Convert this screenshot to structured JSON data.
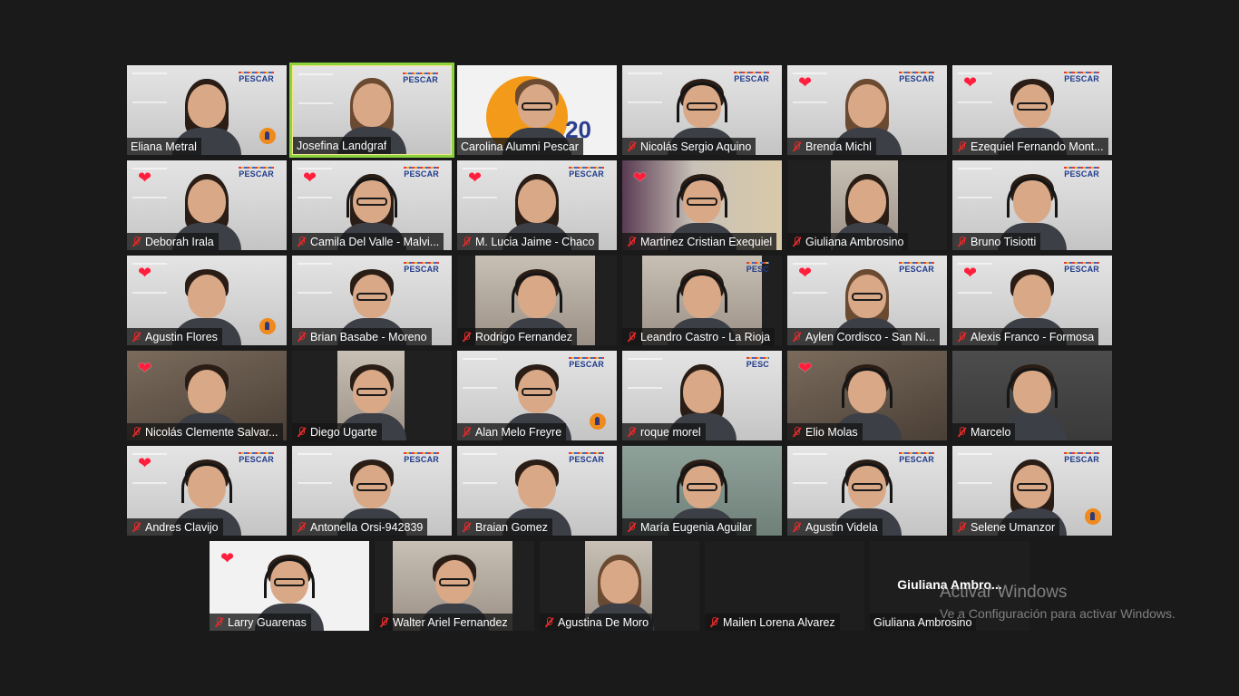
{
  "app": "Zoom gallery view",
  "participants": [
    {
      "name": "Eliana Metral",
      "muted": false,
      "heart": false,
      "brand": "PESCAR"
    },
    {
      "name": "Josefina Landgraf",
      "muted": false,
      "heart": false,
      "brand": "PESCAR",
      "speaking": true
    },
    {
      "name": "Carolina Alumni Pescar",
      "muted": false,
      "heart": false,
      "brand_text": "20"
    },
    {
      "name": "Nicolás Sergio Aquino",
      "muted": true,
      "heart": false,
      "brand": "PESCAR"
    },
    {
      "name": "Brenda Michl",
      "muted": true,
      "heart": true,
      "brand": "PESCAR"
    },
    {
      "name": "Ezequiel Fernando Mont...",
      "muted": true,
      "heart": true,
      "brand": "PESCAR"
    },
    {
      "name": "Deborah Irala",
      "muted": true,
      "heart": true,
      "brand": "PESCAR"
    },
    {
      "name": "Camila Del Valle - Malvi...",
      "muted": true,
      "heart": true,
      "brand": "PESCAR"
    },
    {
      "name": "M. Lucia Jaime - Chaco",
      "muted": true,
      "heart": true,
      "brand": "PESCAR"
    },
    {
      "name": "Martinez Cristian Exequiel",
      "muted": true,
      "heart": true
    },
    {
      "name": "Giuliana Ambrosino",
      "muted": true,
      "heart": false
    },
    {
      "name": "Bruno Tisiotti",
      "muted": true,
      "heart": false,
      "brand": "PESCAR"
    },
    {
      "name": "Agustin Flores",
      "muted": true,
      "heart": true
    },
    {
      "name": "Brian Basabe - Moreno",
      "muted": true,
      "heart": false,
      "brand": "PESCAR"
    },
    {
      "name": "Rodrigo Fernandez",
      "muted": true,
      "heart": false
    },
    {
      "name": "Leandro Castro - La Rioja",
      "muted": true,
      "heart": false,
      "brand": "PESC"
    },
    {
      "name": "Aylen Cordisco -  San Ni...",
      "muted": true,
      "heart": true,
      "brand": "PESCAR"
    },
    {
      "name": "Alexis Franco - Formosa",
      "muted": true,
      "heart": true,
      "brand": "PESCAR"
    },
    {
      "name": "Nicolás Clemente Salvar...",
      "muted": true,
      "heart": true
    },
    {
      "name": "Diego Ugarte",
      "muted": true,
      "heart": false
    },
    {
      "name": "Alan Melo Freyre",
      "muted": true,
      "heart": false,
      "brand": "PESCAR"
    },
    {
      "name": "roque morel",
      "muted": true,
      "heart": false,
      "brand": "PESC"
    },
    {
      "name": "Elio Molas",
      "muted": true,
      "heart": true
    },
    {
      "name": "Marcelo",
      "muted": true,
      "heart": false
    },
    {
      "name": "Andres Clavijo",
      "muted": true,
      "heart": true,
      "brand": "PESCAR"
    },
    {
      "name": "Antonella Orsi-942839",
      "muted": true,
      "heart": false,
      "brand": "PESCAR"
    },
    {
      "name": "Braian Gomez",
      "muted": true,
      "heart": false,
      "brand": "PESCAR"
    },
    {
      "name": "María Eugenia Aguilar",
      "muted": true,
      "heart": false
    },
    {
      "name": "Agustin Videla",
      "muted": true,
      "heart": false,
      "brand": "PESCAR"
    },
    {
      "name": "Selene Umanzor",
      "muted": true,
      "heart": false,
      "brand": "PESCAR"
    },
    {
      "name": "Larry Guarenas",
      "muted": true,
      "heart": true
    },
    {
      "name": "Walter Ariel Fernandez",
      "muted": true,
      "heart": false
    },
    {
      "name": "Agustina De Moro",
      "muted": true,
      "heart": false
    },
    {
      "name": "Mailen Lorena Alvarez",
      "muted": true,
      "heart": false
    },
    {
      "name": "Giuliana Ambrosino",
      "muted": false,
      "heart": false,
      "center_label": "Giuliana  Ambro..."
    }
  ],
  "watermark": {
    "title": "Activar Windows",
    "subtitle": "Ve a Configuración para activar Windows."
  },
  "icons": {
    "mute": "mic-muted-icon",
    "reaction": "heart-icon",
    "badge": "pescar-logo-icon"
  },
  "colors": {
    "background": "#1a1a1a",
    "speaker_outline": "#8ad23e",
    "mute_red": "#e02a2a",
    "heart_red": "#ff1f3d",
    "brand_blue": "#1f3a8a",
    "brand_orange": "#f08a1c"
  }
}
